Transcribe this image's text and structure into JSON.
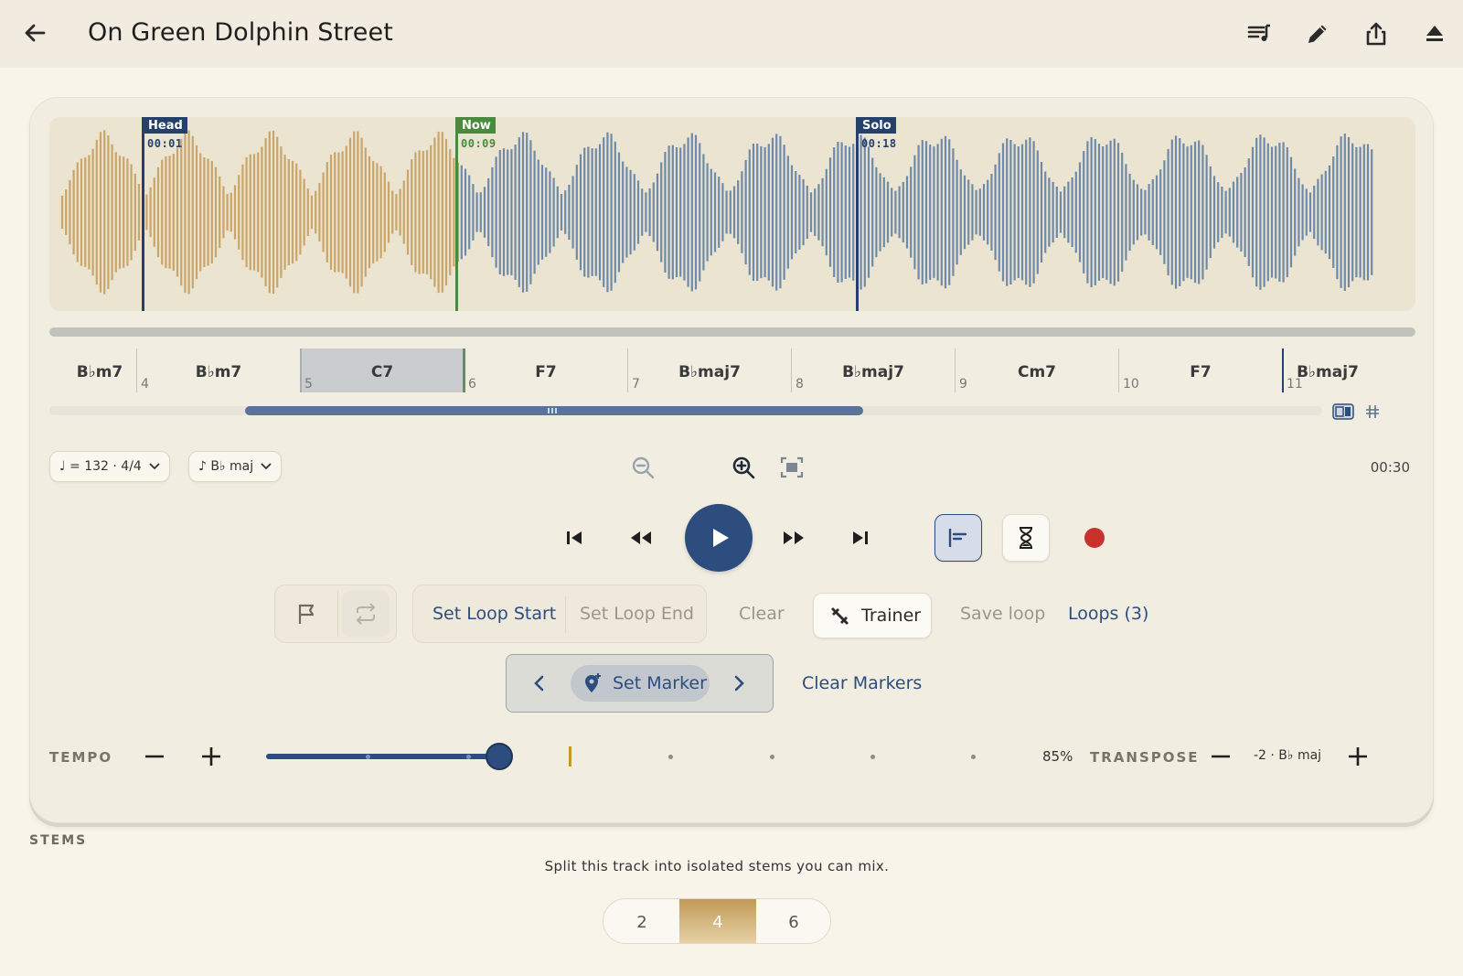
{
  "header": {
    "title": "On Green Dolphin Street"
  },
  "waveform": {
    "played_color": "#c9a56a",
    "unplayed_color": "#6f8aa8",
    "markers": [
      {
        "label": "Head",
        "time": "00:01",
        "color": "#24406b"
      },
      {
        "label": "Now",
        "time": "00:09",
        "color": "#4a8a3e"
      },
      {
        "label": "Solo",
        "time": "00:18",
        "color": "#24406b"
      }
    ]
  },
  "chords": {
    "names": [
      "B♭m7",
      "B♭m7",
      "C7",
      "F7",
      "B♭maj7",
      "B♭maj7",
      "Cm7",
      "F7",
      "B♭maj7"
    ],
    "bars": [
      "4",
      "5",
      "6",
      "7",
      "8",
      "9",
      "10",
      "11"
    ],
    "selected_index": 2
  },
  "settings": {
    "tempo_pill": "♩ = 132 · 4/4",
    "key_pill": "♪ B♭ maj",
    "total_time": "00:30"
  },
  "loop": {
    "set_start": "Set Loop Start",
    "set_end": "Set Loop End",
    "clear": "Clear",
    "trainer": "Trainer",
    "save": "Save loop",
    "loops": "Loops (3)"
  },
  "markers": {
    "set_marker": "Set Marker",
    "clear_markers": "Clear Markers"
  },
  "tempo": {
    "label": "TEMPO",
    "value_fraction": 0.85,
    "percent_label": "85%"
  },
  "transpose": {
    "label": "TRANSPOSE",
    "value": "-2 · B♭ maj"
  },
  "stems": {
    "label": "STEMS",
    "description": "Split this track into isolated stems you can mix.",
    "options": [
      "2",
      "4",
      "6"
    ],
    "selected": "4"
  },
  "colors": {
    "accent": "#2c4d7e",
    "record": "#c9322c",
    "background": "#f8f4ea"
  }
}
